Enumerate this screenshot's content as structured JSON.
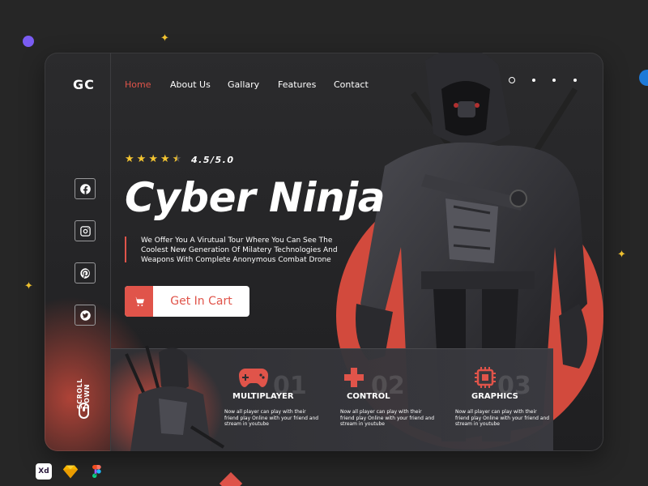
{
  "brand": {
    "logo": "GC"
  },
  "nav": {
    "items": [
      {
        "label": "Home",
        "active": true
      },
      {
        "label": "About Us",
        "active": false
      },
      {
        "label": "Gallary",
        "active": false
      },
      {
        "label": "Features",
        "active": false
      },
      {
        "label": "Contact",
        "active": false
      }
    ]
  },
  "social": [
    "facebook-icon",
    "instagram-icon",
    "pinterest-icon",
    "twitter-icon"
  ],
  "scroll": {
    "label": "SCROLL DOWN"
  },
  "hero": {
    "stars": 4.5,
    "rating": "4.5/5.0",
    "title": "Cyber Ninja",
    "description": "We Offer You A Virutual Tour Where You Can See The Coolest New Generation Of Milatery Technologies And Weapons With Complete Anonymous Combat Drone",
    "cta": "Get In Cart"
  },
  "features": [
    {
      "number": "01",
      "name": "MULTIPLAYER",
      "icon": "gamepad-icon",
      "text": "Now all player can play with their friend play Online with your friend and stream in youtube"
    },
    {
      "number": "02",
      "name": "CONTROL",
      "icon": "dpad-icon",
      "text": "Now all player can play with their friend play Online with your friend and stream in youtube"
    },
    {
      "number": "03",
      "name": "GRAPHICS",
      "icon": "chip-icon",
      "text": "Now all player can play with their friend play Online with your friend and stream in youtube"
    }
  ],
  "tools": [
    {
      "name": "adobe-xd-icon",
      "label": "Xd"
    },
    {
      "name": "sketch-icon",
      "label": ""
    },
    {
      "name": "figma-icon",
      "label": ""
    }
  ],
  "colors": {
    "accent": "#e0544a",
    "background": "#262626",
    "card": "#2b2b2d",
    "star": "#f4c531"
  }
}
